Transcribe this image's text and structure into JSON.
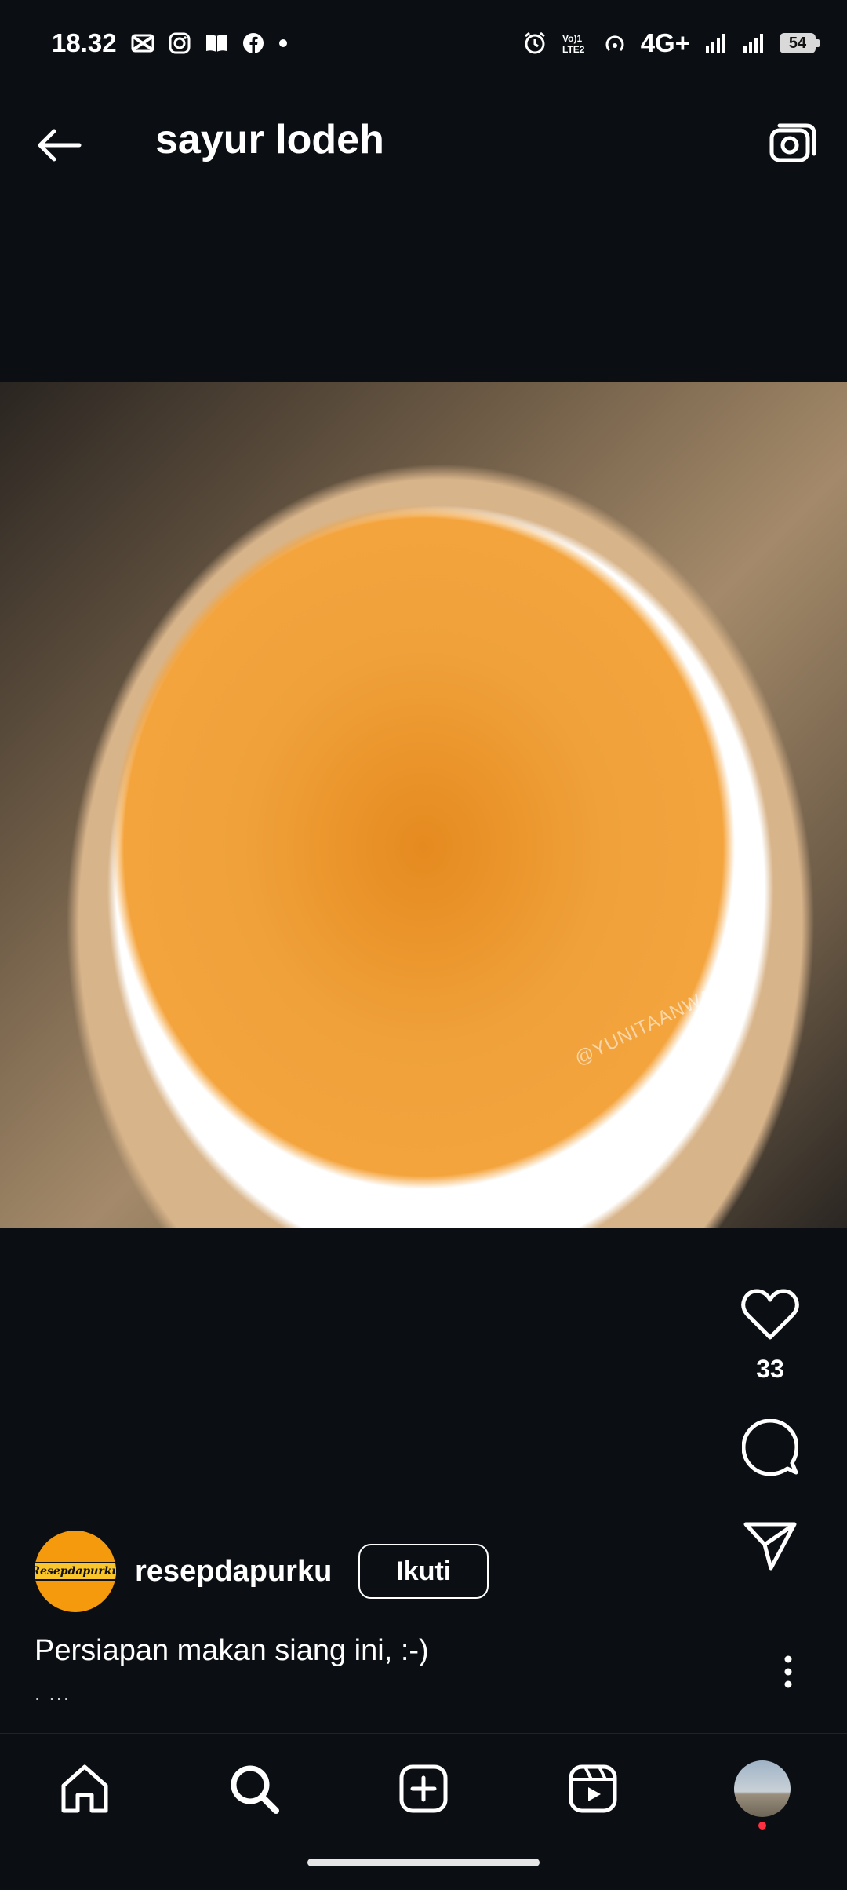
{
  "status_bar": {
    "time": "18.32",
    "network": "4G+",
    "battery": "54"
  },
  "header": {
    "title": "sayur lodeh"
  },
  "post": {
    "watermark": "@YUNITAANWAR",
    "likes": "33",
    "author": "resepdapurku",
    "avatar_text": "Resepdapurku",
    "follow_label": "Ikuti",
    "caption": "Persiapan makan siang ini, :-)",
    "caption_more": ". ..."
  },
  "colors": {
    "background": "#0b0f14",
    "avatar_bg": "#f59a0c",
    "notification_dot": "#ff3040"
  }
}
